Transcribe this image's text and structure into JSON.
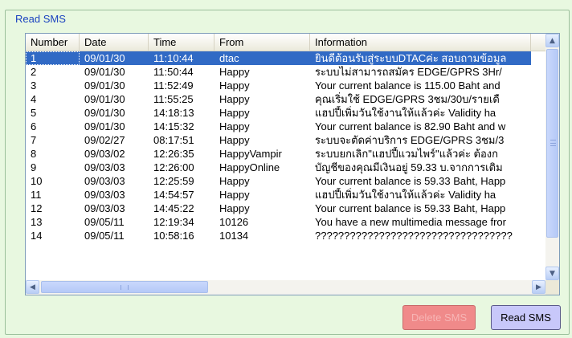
{
  "group": {
    "title": "Read SMS"
  },
  "table": {
    "columns": [
      "Number",
      "Date",
      "Time",
      "From",
      "Information"
    ],
    "rows": [
      [
        "1",
        "09/01/30",
        "11:10:44",
        "dtac",
        "ยินดีต้อนรับสู่ระบบDTACค่ะ สอบถามข้อมูล"
      ],
      [
        "2",
        "09/01/30",
        "11:50:44",
        "Happy",
        "ระบบไม่สามารถสมัคร EDGE/GPRS 3Hr/"
      ],
      [
        "3",
        "09/01/30",
        "11:52:49",
        "Happy",
        "Your current balance is 115.00 Baht and"
      ],
      [
        "4",
        "09/01/30",
        "11:55:25",
        "Happy",
        "คุณเริ่มใช้ EDGE/GPRS 3ชม/30บ/รายเดื"
      ],
      [
        "5",
        "09/01/30",
        "14:18:13",
        "Happy",
        "แฮปปี้เพิ่มวันใช้งานให้แล้วค่ะ Validity ha"
      ],
      [
        "6",
        "09/01/30",
        "14:15:32",
        "Happy",
        "Your current balance is 82.90 Baht and w"
      ],
      [
        "7",
        "09/02/27",
        "08:17:51",
        "Happy",
        "ระบบจะตัดค่าบริการ EDGE/GPRS 3ชม/3"
      ],
      [
        "8",
        "09/03/02",
        "12:26:35",
        "HappyVampir",
        "ระบบยกเลิก\"แฮปปี้แวมไพร์\"แล้วค่ะ ต้องก"
      ],
      [
        "9",
        "09/03/03",
        "12:26:00",
        "HappyOnline",
        "บัญชีของคุณมีเงินอยู่ 59.33 บ.จากการเติม"
      ],
      [
        "10",
        "09/03/03",
        "12:25:59",
        "Happy",
        "Your current balance is 59.33 Baht, Happ"
      ],
      [
        "11",
        "09/03/03",
        "14:54:57",
        "Happy",
        "แฮปปี้เพิ่มวันใช้งานให้แล้วค่ะ Validity ha"
      ],
      [
        "12",
        "09/03/03",
        "14:45:22",
        "Happy",
        "Your current balance is 59.33 Baht, Happ"
      ],
      [
        "13",
        "09/05/11",
        "12:19:34",
        "10126",
        "You have a new multimedia message fror"
      ],
      [
        "14",
        "09/05/11",
        "10:58:16",
        "10134",
        "??????????????????????????????????"
      ]
    ],
    "selected_row": 0,
    "colors": {
      "selection": "#316ac5",
      "header_bg": "#ebeadb"
    }
  },
  "buttons": {
    "delete_label": "Delete SMS",
    "read_label": "Read SMS",
    "delete_color": "#f08a8a",
    "read_color": "#c8c8fa"
  },
  "icons": {
    "scroll_up": "chevron-up-icon",
    "scroll_down": "chevron-down-icon",
    "scroll_left": "chevron-left-icon",
    "scroll_right": "chevron-right-icon"
  }
}
